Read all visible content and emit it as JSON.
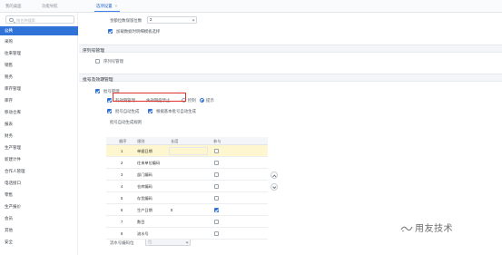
{
  "tabs": [
    {
      "label": "我的桌面",
      "active": false
    },
    {
      "label": "功能导航",
      "active": false
    },
    {
      "label": "选项设置",
      "active": true
    }
  ],
  "tab_close_glyph": "×",
  "search": {
    "placeholder": "按名称搜索"
  },
  "sidebar": {
    "items": [
      {
        "label": "公共",
        "active": true
      },
      {
        "label": "采购"
      },
      {
        "label": "往来管理"
      },
      {
        "label": "销售"
      },
      {
        "label": "税务"
      },
      {
        "label": "库存管理"
      },
      {
        "label": "库存"
      },
      {
        "label": "移动仓库"
      },
      {
        "label": "报表"
      },
      {
        "label": "财务"
      },
      {
        "label": "生产管理"
      },
      {
        "label": "新建计件"
      },
      {
        "label": "合作人管理"
      },
      {
        "label": "电话接口"
      },
      {
        "label": "零售"
      },
      {
        "label": "生产报价"
      },
      {
        "label": "会员"
      },
      {
        "label": "其他"
      },
      {
        "label": "安全"
      }
    ]
  },
  "main": {
    "decimal_label": "金额位数保留位数",
    "decimal_value": "2",
    "top_checkbox_label": "加载数据时明细模板选择",
    "serial_section": {
      "title": "序列号管理",
      "checkbox_label": "序列号管理"
    },
    "batch_section": {
      "title": "批号及效期管理",
      "batch_manage_label": "批号管理",
      "expiry_label": "有效期管理",
      "expiry_radio1": "失效期后禁止",
      "expiry_radio2": "控制",
      "expiry_radio3": "提示",
      "auto_gen_label": "批号自动生成",
      "auto_gen_option_label": "根据基本批号自动生成",
      "rule_label": "批号自动生成规则"
    },
    "grid": {
      "headers": [
        "顺序",
        "规则",
        "长度",
        "参与"
      ],
      "rows": [
        {
          "no": "1",
          "rule": "单据日期",
          "length": "",
          "checked": false,
          "selected": true
        },
        {
          "no": "2",
          "rule": "往来单位编码",
          "length": "",
          "checked": false,
          "selected": false
        },
        {
          "no": "3",
          "rule": "部门编码",
          "length": "",
          "checked": false,
          "selected": false
        },
        {
          "no": "4",
          "rule": "仓库编码",
          "length": "",
          "checked": false,
          "selected": false
        },
        {
          "no": "5",
          "rule": "存货编码",
          "length": "",
          "checked": false,
          "selected": false
        },
        {
          "no": "6",
          "rule": "生产日期",
          "length": "8",
          "checked": true,
          "selected": false
        },
        {
          "no": "7",
          "rule": "数目",
          "length": "",
          "checked": false,
          "selected": false
        },
        {
          "no": "8",
          "rule": "流水号",
          "length": "",
          "checked": false,
          "selected": false
        }
      ]
    },
    "flow_label": "流水号编码位",
    "flow_value": "位"
  },
  "watermark": "用友技术",
  "colors": {
    "accent": "#2f72d8",
    "highlight": "#e0312a",
    "selected_row": "#fdf6cf"
  }
}
